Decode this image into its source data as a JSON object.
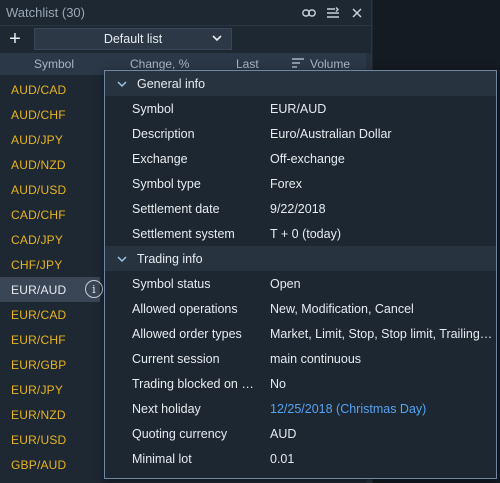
{
  "watchlist": {
    "title": "Watchlist (30)",
    "add_label": "+",
    "list_selector": "Default list",
    "columns": {
      "symbol": "Symbol",
      "change": "Change, %",
      "last": "Last",
      "volume": "Volume"
    },
    "rows": [
      "AUD/CAD",
      "AUD/CHF",
      "AUD/JPY",
      "AUD/NZD",
      "AUD/USD",
      "CAD/CHF",
      "CAD/JPY",
      "CHF/JPY",
      "EUR/AUD",
      "EUR/CAD",
      "EUR/CHF",
      "EUR/GBP",
      "EUR/JPY",
      "EUR/NZD",
      "EUR/USD",
      "GBP/AUD"
    ],
    "selected_symbol": "EUR/AUD",
    "info_glyph": "i"
  },
  "popup": {
    "general": {
      "title": "General info",
      "rows": [
        {
          "key": "Symbol",
          "value": "EUR/AUD"
        },
        {
          "key": "Description",
          "value": "Euro/Australian Dollar"
        },
        {
          "key": "Exchange",
          "value": "Off-exchange"
        },
        {
          "key": "Symbol type",
          "value": "Forex"
        },
        {
          "key": "Settlement date",
          "value": "9/22/2018"
        },
        {
          "key": "Settlement system",
          "value": "T + 0 (today)"
        }
      ]
    },
    "trading": {
      "title": "Trading info",
      "rows": [
        {
          "key": "Symbol status",
          "value": "Open"
        },
        {
          "key": "Allowed operations",
          "value": "New, Modification, Cancel"
        },
        {
          "key": "Allowed order types",
          "value": "Market, Limit, Stop, Stop limit, Trailing stop"
        },
        {
          "key": "Current session",
          "value": "main continuous"
        },
        {
          "key": "Trading blocked on close",
          "value": "No"
        },
        {
          "key": "Next holiday",
          "value": "12/25/2018 (Christmas Day)"
        },
        {
          "key": "Quoting currency",
          "value": "AUD"
        },
        {
          "key": "Minimal lot",
          "value": "0.01"
        }
      ]
    }
  },
  "colors": {
    "symbol_text": "#e8b41f",
    "link": "#55a3f2",
    "popup_border": "#6f87a3"
  }
}
